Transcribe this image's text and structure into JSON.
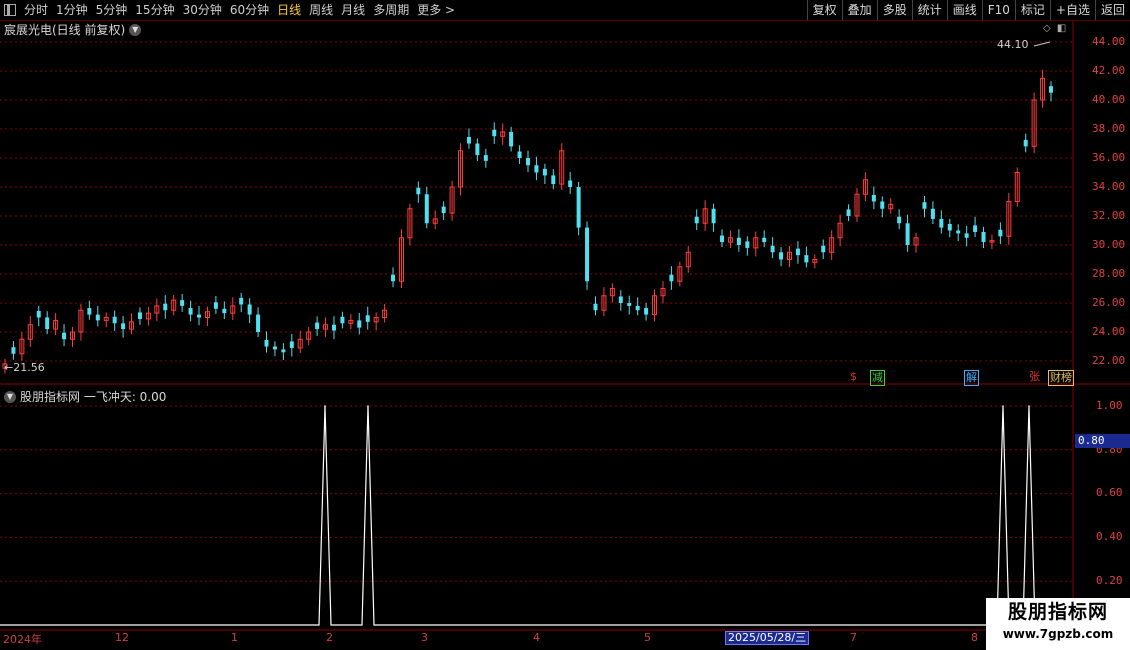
{
  "toolbar": {
    "periods": [
      "分时",
      "1分钟",
      "5分钟",
      "15分钟",
      "30分钟",
      "60分钟",
      "日线",
      "周线",
      "月线",
      "多周期",
      "更多 >"
    ],
    "active": "日线",
    "buttons": [
      "复权",
      "叠加",
      "多股",
      "统计",
      "画线",
      "F10",
      "+自选",
      "返回"
    ],
    "mark_label": "标记"
  },
  "stock": {
    "title": "宸展光电(日线 前复权)"
  },
  "price_axis": [
    "44.00",
    "42.00",
    "40.00",
    "38.00",
    "36.00",
    "34.00",
    "32.00",
    "30.00",
    "28.00",
    "26.00",
    "24.00",
    "22.00"
  ],
  "markers": {
    "low": "←21.56",
    "high": "44.10"
  },
  "events": [
    {
      "label": "$",
      "color": "#e03030"
    },
    {
      "label": "减",
      "color": "#40d040"
    },
    {
      "label": "解",
      "color": "#40b0ff"
    },
    {
      "label": "张",
      "color": "#e03030"
    },
    {
      "label": "财榜",
      "color": "#e0c060"
    }
  ],
  "indicator": {
    "title": "股朋指标网 一飞冲天: 0.00",
    "value_box": "0.80"
  },
  "indicator_axis": [
    "1.00",
    "0.80",
    "0.60",
    "0.40",
    "0.20"
  ],
  "time_axis": [
    "2024年",
    "12",
    "1",
    "2",
    "3",
    "4",
    "5",
    "7",
    "8"
  ],
  "cursor_date": "2025/05/28/三",
  "watermark": {
    "line1": "股朋指标网",
    "line2": "www.7gpzb.com"
  },
  "colors": {
    "up": "#ff3c3c",
    "down": "#50e0f0",
    "grid": "#8a0000",
    "signal": "#ffffff"
  },
  "chart_data": [
    {
      "type": "candlestick",
      "title": "宸展光电(日线 前复权)",
      "ylim": [
        21,
        45
      ],
      "high": 44.1,
      "low": 21.56,
      "close_series": [
        21.8,
        22.5,
        23.5,
        24.5,
        25.0,
        24.2,
        24.8,
        23.5,
        24.0,
        25.5,
        25.2,
        24.8,
        25.0,
        24.6,
        24.2,
        24.7,
        24.9,
        25.3,
        25.8,
        25.5,
        26.2,
        25.8,
        25.2,
        25.0,
        25.4,
        25.6,
        25.3,
        25.8,
        25.9,
        25.2,
        24.0,
        23.0,
        22.8,
        22.6,
        22.9,
        23.5,
        24.0,
        24.2,
        24.5,
        24.1,
        24.6,
        24.8,
        24.3,
        24.7,
        25.0,
        25.5,
        27.5,
        30.5,
        32.5,
        33.5,
        31.5,
        31.8,
        32.2,
        34.0,
        36.5,
        37.0,
        36.2,
        35.8,
        37.5,
        37.8,
        36.8,
        36.0,
        35.5,
        35.0,
        34.8,
        34.2,
        36.5,
        34.0,
        31.2,
        27.5,
        25.5,
        26.5,
        27.0,
        26.0,
        25.8,
        25.5,
        25.2,
        26.5,
        27.0,
        27.5,
        28.5,
        29.5,
        31.5,
        32.5,
        31.5,
        30.2,
        30.5,
        30.0,
        29.8,
        30.5,
        30.2,
        29.5,
        29.0,
        29.5,
        29.3,
        28.8,
        29.0,
        29.5,
        30.5,
        31.5,
        32.0,
        33.5,
        34.5,
        33.0,
        32.5,
        32.8,
        31.5,
        30.0,
        30.5,
        32.5,
        31.8,
        31.2,
        31.0,
        30.8,
        30.5,
        30.9,
        30.2,
        30.3,
        30.6,
        33.0,
        35.0,
        36.8,
        40.0,
        41.5,
        40.5
      ],
      "signal_days": [
        {
          "date": "2025-02 (early)",
          "value": 1.0
        },
        {
          "date": "2025-02 (mid)",
          "value": 1.0
        },
        {
          "date": "2025-08 (early)",
          "value": 1.0
        },
        {
          "date": "2025-08 (mid)",
          "value": 1.0
        }
      ],
      "indicator_name": "一飞冲天",
      "indicator_ylim": [
        0,
        1.05
      ]
    }
  ]
}
